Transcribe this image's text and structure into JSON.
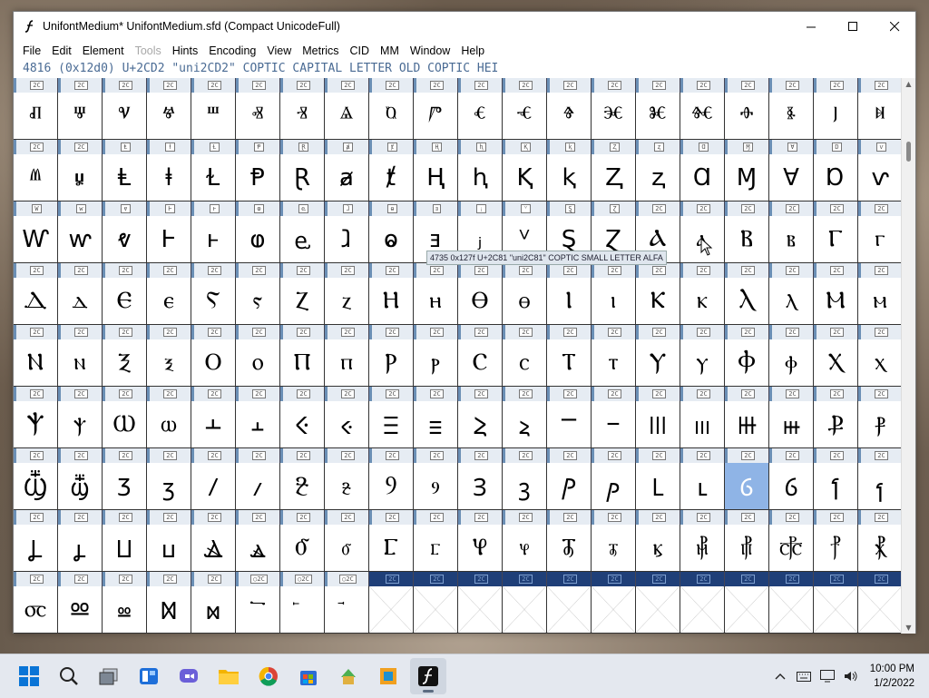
{
  "window": {
    "title": "UnifontMedium*  UnifontMedium.sfd (Compact UnicodeFull)",
    "menus": [
      {
        "label": "File",
        "disabled": false
      },
      {
        "label": "Edit",
        "disabled": false
      },
      {
        "label": "Element",
        "disabled": false
      },
      {
        "label": "Tools",
        "disabled": true
      },
      {
        "label": "Hints",
        "disabled": false
      },
      {
        "label": "Encoding",
        "disabled": false
      },
      {
        "label": "View",
        "disabled": false
      },
      {
        "label": "Metrics",
        "disabled": false
      },
      {
        "label": "CID",
        "disabled": false
      },
      {
        "label": "MM",
        "disabled": false
      },
      {
        "label": "Window",
        "disabled": false
      },
      {
        "label": "Help",
        "disabled": false
      }
    ],
    "info_line": "4816 (0x12d0) U+2CD2 \"uni2CD2\" COPTIC CAPITAL LETTER OLD COPTIC HEI",
    "tooltip": "4735 0x127f U+2C81 \"uni2C81\" COPTIC SMALL LETTER ALFA"
  },
  "grid": {
    "rows": [
      {
        "labels": [
          "2C\n4A",
          "2C\n4B",
          "2C\n4C",
          "2C\n4D",
          "2C\n4E",
          "2C\n4F",
          "2C\n50",
          "2C\n51",
          "2C\n52",
          "2C\n53",
          "2C\n54",
          "2C\n55",
          "2C\n56",
          "2C\n57",
          "2C\n58",
          "2C\n59",
          "2C\n5A",
          "2C\n5B",
          "2C\n5C",
          "2C\n5D"
        ],
        "glyphs": [
          "ⱊ",
          "ⱋ",
          "ⱌ",
          "ⱍ",
          "ⱎ",
          "ⱏ",
          "ⱐ",
          "ⱑ",
          "ⱒ",
          "ⱓ",
          "ⱔ",
          "ⱕ",
          "ⱖ",
          "ⱗ",
          "ⱘ",
          "ⱙ",
          "ⱚ",
          "ⱛ",
          "ⱜ",
          "ⱝ"
        ]
      },
      {
        "labels": [
          "2C\n5E",
          "2C\n5F",
          "Ⱡ",
          "ⱡ",
          "Ɫ",
          "Ᵽ",
          "Ɽ",
          "ⱥ",
          "ⱦ",
          "Ⱨ",
          "ⱨ",
          "Ⱪ",
          "ⱪ",
          "Ⱬ",
          "ⱬ",
          "Ɑ",
          "Ɱ",
          "Ɐ",
          "Ɒ",
          "ⱱ"
        ],
        "glyphs": [
          "ⱞ",
          "ⱟ",
          "Ⱡ",
          "ⱡ",
          "Ɫ",
          "Ᵽ",
          "Ɽ",
          "ⱥ",
          "ⱦ",
          "Ⱨ",
          "ⱨ",
          "Ⱪ",
          "ⱪ",
          "Ⱬ",
          "ⱬ",
          "Ɑ",
          "Ɱ",
          "Ɐ",
          "Ɒ",
          "ⱱ"
        ]
      },
      {
        "labels": [
          "Ⱳ",
          "ⱳ",
          "ⱴ",
          "Ⱶ",
          "ⱶ",
          "ⱷ",
          "ⱸ",
          "ⱹ",
          "ⱺ",
          "ⱻ",
          "ⱼ",
          "ⱽ",
          "Ȿ",
          "Ɀ",
          "2C\n80",
          "2C\n81",
          "2C\n82",
          "2C\n83",
          "2C\n84",
          "2C\n85"
        ],
        "glyphs": [
          "Ⱳ",
          "ⱳ",
          "ⱴ",
          "Ⱶ",
          "ⱶ",
          "ⱷ",
          "ⱸ",
          "ⱹ",
          "ⱺ",
          "ⱻ",
          "ⱼ",
          "ⱽ",
          "Ȿ",
          "Ɀ",
          "Ⲁ",
          "ⲁ",
          "Ⲃ",
          "ⲃ",
          "Ⲅ",
          "ⲅ"
        ]
      },
      {
        "labels": [
          "2C\n86",
          "2C\n87",
          "2C\n88",
          "2C\n89",
          "2C\n8A",
          "2C\n8B",
          "2C\n8C",
          "2C\n8D",
          "2C\n8E",
          "2C\n8F",
          "2C\n90",
          "2C\n91",
          "2C\n92",
          "2C\n93",
          "2C\n94",
          "2C\n95",
          "2C\n96",
          "2C\n97",
          "2C\n98",
          "2C\n99"
        ],
        "glyphs": [
          "Ⲇ",
          "ⲇ",
          "Ⲉ",
          "ⲉ",
          "Ⲋ",
          "ⲋ",
          "Ⲍ",
          "ⲍ",
          "Ⲏ",
          "ⲏ",
          "Ⲑ",
          "ⲑ",
          "Ⲓ",
          "ⲓ",
          "Ⲕ",
          "ⲕ",
          "Ⲗ",
          "ⲗ",
          "Ⲙ",
          "ⲙ"
        ]
      },
      {
        "labels": [
          "2C\n9A",
          "2C\n9B",
          "2C\n9C",
          "2C\n9D",
          "2C\n9E",
          "2C\n9F",
          "2C\nA0",
          "2C\nA1",
          "2C\nA2",
          "2C\nA3",
          "2C\nA4",
          "2C\nA5",
          "2C\nA6",
          "2C\nA7",
          "2C\nA8",
          "2C\nA9",
          "2C\nAA",
          "2C\nAB",
          "2C\nAC",
          "2C\nAD"
        ],
        "glyphs": [
          "Ⲛ",
          "ⲛ",
          "Ⲝ",
          "ⲝ",
          "Ⲟ",
          "ⲟ",
          "Ⲡ",
          "ⲡ",
          "Ⲣ",
          "ⲣ",
          "Ⲥ",
          "ⲥ",
          "Ⲧ",
          "ⲧ",
          "Ⲩ",
          "ⲩ",
          "Ⲫ",
          "ⲫ",
          "Ⲭ",
          "ⲭ"
        ]
      },
      {
        "labels": [
          "2C\nAE",
          "2C\nAF",
          "2C\nB0",
          "2C\nB1",
          "2C\nB2",
          "2C\nB3",
          "2C\nB4",
          "2C\nB5",
          "2C\nB6",
          "2C\nB7",
          "2C\nB8",
          "2C\nB9",
          "2C\nBA",
          "2C\nBB",
          "2C\nBC",
          "2C\nBD",
          "2C\nBE",
          "2C\nBF",
          "2C\nC0",
          "2C\nC1"
        ],
        "glyphs": [
          "Ⲯ",
          "ⲯ",
          "Ⲱ",
          "ⲱ",
          "Ⲳ",
          "ⲳ",
          "Ⲵ",
          "ⲵ",
          "Ⲷ",
          "ⲷ",
          "Ⲹ",
          "ⲹ",
          "Ⲻ",
          "ⲻ",
          "Ⲽ",
          "ⲽ",
          "Ⲿ",
          "ⲿ",
          "Ⳁ",
          "ⳁ"
        ]
      },
      {
        "labels": [
          "2C\nC2",
          "2C\nC3",
          "2C\nC4",
          "2C\nC5",
          "2C\nC6",
          "2C\nC7",
          "2C\nC8",
          "2C\nC9",
          "2C\nCA",
          "2C\nCB",
          "2C\nCC",
          "2C\nCD",
          "2C\nCE",
          "2C\nCF",
          "2C\nD0",
          "2C\nD1",
          "2C\nD2",
          "2C\nD3",
          "2C\nD4",
          "2C\nD5"
        ],
        "glyphs": [
          "Ⳃ",
          "ⳃ",
          "Ⳅ",
          "ⳅ",
          "Ⳇ",
          "ⳇ",
          "Ⳉ",
          "ⳉ",
          "Ⳋ",
          "ⳋ",
          "Ⳍ",
          "ⳍ",
          "Ⳏ",
          "ⳏ",
          "Ⳑ",
          "ⳑ",
          "Ⳓ",
          "ⳓ",
          "Ⳕ",
          "ⳕ"
        ]
      },
      {
        "labels": [
          "2C\nD6",
          "2C\nD7",
          "2C\nD8",
          "2C\nD9",
          "2C\nDA",
          "2C\nDB",
          "2C\nDC",
          "2C\nDD",
          "2C\nDE",
          "2C\nDF",
          "2C\nE0",
          "2C\nE1",
          "2C\nE2",
          "2C\nE3",
          "2C\nE4",
          "2C\nE5",
          "2C\nE6",
          "2C\nE7",
          "2C\nE8",
          "2C\nE9"
        ],
        "glyphs": [
          "Ⳗ",
          "ⳗ",
          "Ⳙ",
          "ⳙ",
          "Ⳛ",
          "ⳛ",
          "Ⳝ",
          "ⳝ",
          "Ⳟ",
          "ⳟ",
          "Ⳡ",
          "ⳡ",
          "Ⳣ",
          "ⳣ",
          "ⳤ",
          "⳥",
          "⳦",
          "⳧",
          "⳨",
          "⳩"
        ]
      },
      {
        "labels": [
          "2C\nEA",
          "2C\nEB",
          "2C\nEC",
          "2C\nED",
          "2C\nEE",
          "○2C\nEF",
          "○2C\nF0",
          "○2C\nF1",
          "2C\nF2",
          "2C\nF3",
          "2C\nF4",
          "2C\nF5",
          "2C\nF6",
          "2C\nF7",
          "2C\nF8",
          "2C\nF9",
          "2C\nFA",
          "2C\nFB",
          "2C\nFC",
          "2C\nFD"
        ],
        "glyphs": [
          "⳪",
          "Ⳬ",
          "ⳬ",
          "Ⳮ",
          "ⳮ",
          "⳯",
          "⳰",
          "⳱",
          "",
          "",
          "",
          "",
          "",
          "",
          "",
          "",
          "",
          "",
          "",
          ""
        ]
      }
    ],
    "selected": {
      "row": 6,
      "col": 16
    },
    "blue_label_from": {
      "row": 8,
      "col": 8
    },
    "empty_from": {
      "row": 8,
      "col": 8
    }
  },
  "taskbar": {
    "apps": [
      "start-icon",
      "search-icon",
      "task-view-icon",
      "widgets-icon",
      "chat-icon",
      "file-explorer-icon",
      "chrome-icon",
      "store-icon",
      "app-icon-1",
      "app-icon-2",
      "fontforge-icon"
    ],
    "time": "10:00 PM",
    "date": "1/2/2022"
  }
}
